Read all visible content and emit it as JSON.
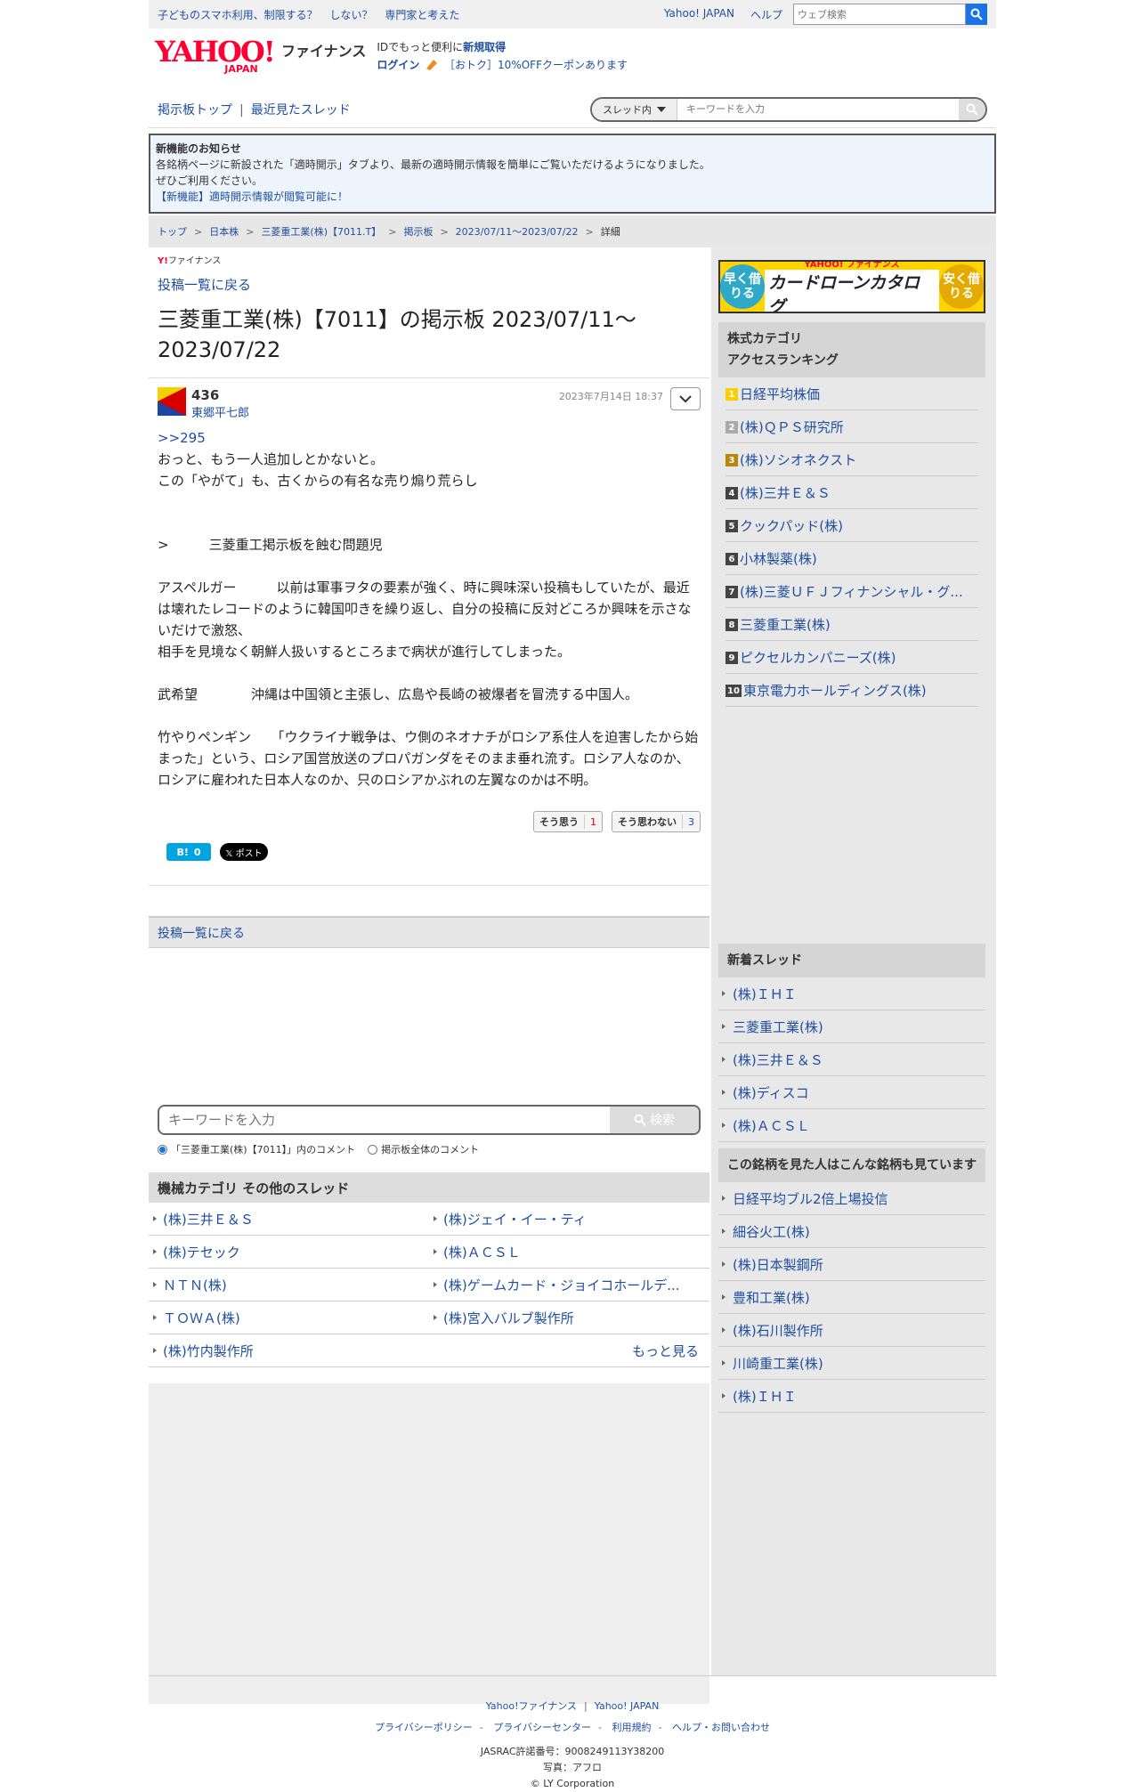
{
  "topbar": {
    "promo": [
      "子どものスマホ利用、制限する？",
      "しない？",
      "専門家と考えた"
    ],
    "links": [
      "Yahoo! JAPAN",
      "ヘルプ"
    ],
    "search_placeholder": "ウェブ検索"
  },
  "header": {
    "logo_word": "YAHOO!",
    "logo_sub": "JAPAN",
    "site_name": "ファイナンス",
    "msg_prefix": "IDでもっと便利に",
    "register": "新規取得",
    "login": "ログイン",
    "coupon": "［おトク］10%OFFクーポンあります"
  },
  "nav": {
    "board_top": "掲示板トップ",
    "recent": "最近見たスレッド",
    "scope": "スレッド内",
    "search_placeholder": "キーワードを入力"
  },
  "notice": {
    "title": "新機能のお知らせ",
    "line1": "各銘柄ページに新設された「適時開示」タブより、最新の適時開示情報を簡単にご覧いただけるようになりました。",
    "line2": "ぜひご利用ください。",
    "link": "【新機能】適時開示情報が閲覧可能に！"
  },
  "breadcrumb": [
    "トップ",
    "日本株",
    "三菱重工業(株)【7011.T】",
    "掲示板",
    "2023/07/11〜2023/07/22",
    "詳細"
  ],
  "main": {
    "mini_logo_y": "Y!",
    "mini_logo": "ファイナンス",
    "back": "投稿一覧に戻る",
    "title": "三菱重工業(株)【7011】の掲示板 2023/07/11〜2023/07/22"
  },
  "post": {
    "number": "436",
    "author": "東郷平七郎",
    "date": "2023年7月14日 18:37",
    "reply_ref": ">>295",
    "body": "おっと、もう一人追加しとかないと。\nこの「やがて」も、古くからの有名な売り煽り荒らし\n\n\n>　　　三菱重工掲示板を蝕む問題児\n\nアスペルガー　　　以前は軍事ヲタの要素が強く、時に興味深い投稿もしていたが、最近は壊れたレコードのように韓国叩きを繰り返し、自分の投稿に反対どころか興味を示さないだけで激怒、\n相手を見境なく朝鮮人扱いするところまで病状が進行してしまった。\n\n武希望　　　　沖縄は中国領と主張し、広島や長崎の被爆者を冒涜する中国人。\n\n竹やりペンギン　　「ウクライナ戦争は、ウ側のネオナチがロシア系住人を迫害したから始まった」という、ロシア国営放送のプロパガンダをそのまま垂れ流す。ロシア人なのか、ロシアに雇われた日本人なのか、只のロシアかぶれの左翼なのかは不明。",
    "agree_label": "そう思う",
    "agree_count": "1",
    "disagree_label": "そう思わない",
    "disagree_count": "3",
    "hatena_label": "B!",
    "hatena_count": "0",
    "x_label": "𝕏 ポスト"
  },
  "back_bottom": "投稿一覧に戻る",
  "bottom_search": {
    "placeholder": "キーワードを入力",
    "button": "検索",
    "radio1": "「三菱重工業(株)【7011】」内のコメント",
    "radio2": "掲示板全体のコメント"
  },
  "category": {
    "title": "機械カテゴリ その他のスレッド",
    "items": [
      "(株)三井Ｅ＆Ｓ",
      "(株)ジェイ・イー・ティ",
      "(株)テセック",
      "(株)ＡＣＳＬ",
      "ＮＴＮ(株)",
      "(株)ゲームカード・ジョイコホールデ...",
      "ＴＯＷＡ(株)",
      "(株)宮入バルブ製作所",
      "(株)竹内製作所"
    ],
    "more": "もっと見る"
  },
  "sidebar": {
    "banner_left": "早く借りる",
    "banner_logo": "YAHOO! ファイナンス",
    "banner_title": "カードローンカタログ",
    "banner_right": "安く借りる",
    "ranking_title": "株式カテゴリ\nアクセスランキング",
    "ranking": [
      "日経平均株価",
      "(株)ＱＰＳ研究所",
      "(株)ソシオネクスト",
      "(株)三井Ｅ＆Ｓ",
      "クックパッド(株)",
      "小林製薬(株)",
      "(株)三菱ＵＦＪフィナンシャル・グ...",
      "三菱重工業(株)",
      "ピクセルカンパニーズ(株)",
      "東京電力ホールディングス(株)"
    ],
    "new_title": "新着スレッド",
    "new_threads": [
      "(株)ＩＨＩ",
      "三菱重工業(株)",
      "(株)三井Ｅ＆Ｓ",
      "(株)ディスコ",
      "(株)ＡＣＳＬ"
    ],
    "viewed_title": "この銘柄を見た人はこんな銘柄も見ています",
    "viewed": [
      "日経平均ブル2倍上場投信",
      "細谷火工(株)",
      "(株)日本製鋼所",
      "豊和工業(株)",
      "(株)石川製作所",
      "川崎重工業(株)",
      "(株)ＩＨＩ"
    ]
  },
  "footer": {
    "row1": [
      "Yahoo!ファイナンス",
      "Yahoo! JAPAN"
    ],
    "row2": [
      "プライバシーポリシー",
      "プライバシーセンター",
      "利用規約",
      "ヘルプ・お問い合わせ"
    ],
    "jasrac": "JASRAC許諾番号：9008249113Y38200",
    "photo": "写真：アフロ",
    "copyright": "© LY Corporation"
  }
}
